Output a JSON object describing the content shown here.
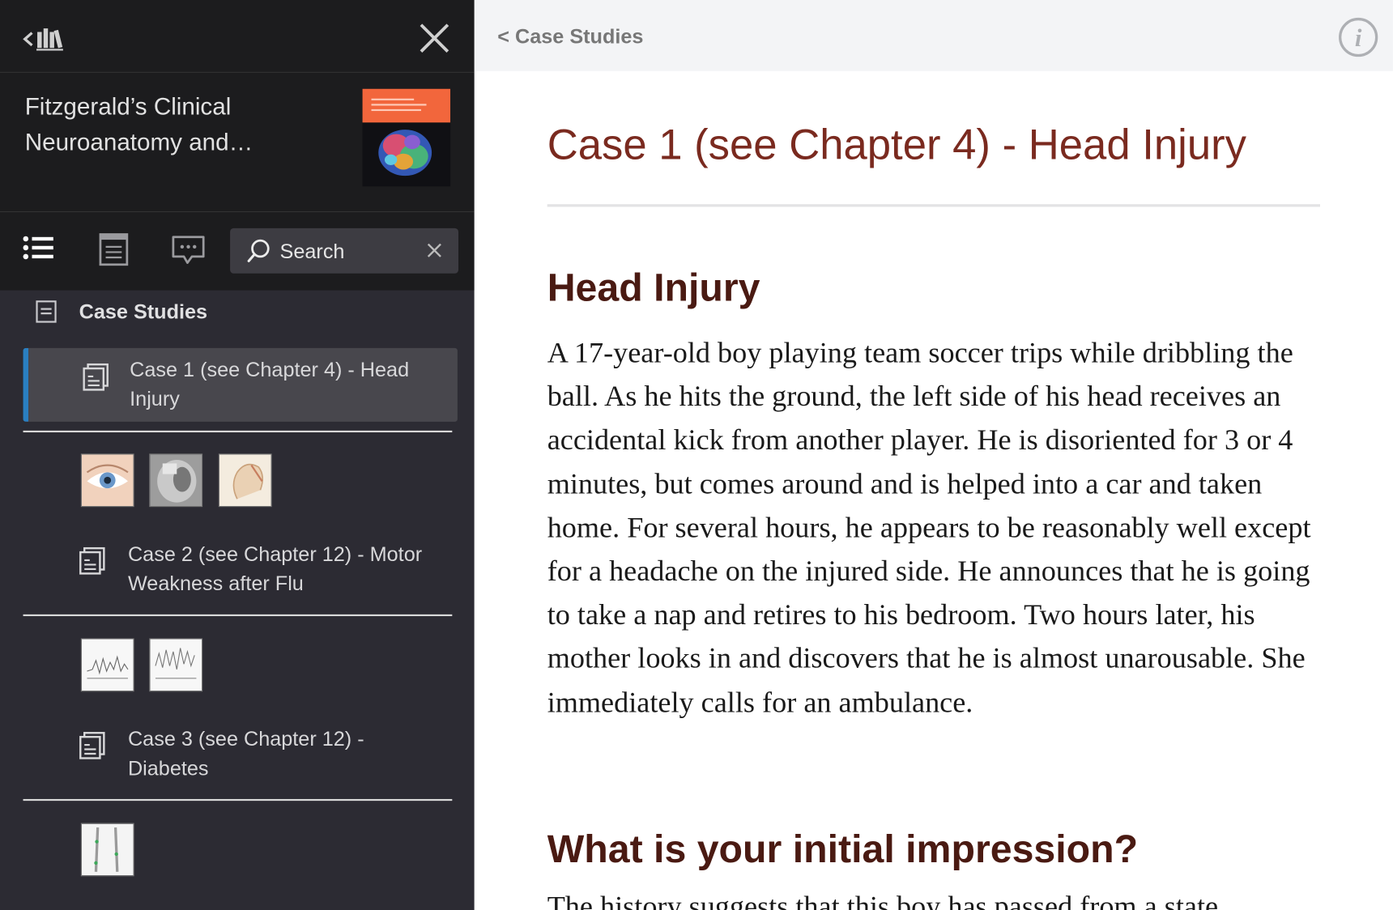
{
  "sidebar": {
    "book_title": "Fitzgerald’s Clinical Neuroanatomy and…",
    "search": {
      "placeholder": "Search"
    },
    "section": {
      "label": "Case Studies"
    },
    "items": [
      {
        "label": "Case 1 (see Chapter 4) - Head Injury",
        "active": true
      },
      {
        "label": "Case 2 (see Chapter 12) - Motor Weakness after Flu",
        "active": false
      },
      {
        "label": "Case 3 (see Chapter 12) - Diabetes",
        "active": false
      }
    ]
  },
  "main": {
    "back_label": "< Case Studies",
    "title": "Case 1 (see Chapter 4) - Head Injury",
    "section1": {
      "heading": "Head Injury",
      "body": "A 17-year-old boy playing team soccer trips while dribbling the ball. As he hits the ground, the left side of his head receives an accidental kick from another player. He is disoriented for 3 or 4 minutes, but comes around and is helped into a car and taken home. For several hours, he appears to be reasonably well except for a headache on the injured side. He announces that he is going to take a nap and retires to his bedroom. Two hours later, his mother looks in and discovers that he is almost unarousable. She immediately calls for an ambulance."
    },
    "section2": {
      "heading": "What is your initial impression?",
      "body": "The history suggests that this boy has passed from a state"
    }
  },
  "colors": {
    "sidebar_bg": "#2c2b33",
    "sidebar_header_bg": "#1c1c1e",
    "active_accent": "#2a7fc1",
    "title_color": "#7a2a1f",
    "heading_color": "#4a1a12",
    "cover_accent": "#f2663c"
  },
  "icons": [
    "library-icon",
    "close-icon",
    "toc-list-icon",
    "notes-icon",
    "comments-icon",
    "search-icon",
    "clear-icon",
    "document-icon",
    "info-icon"
  ]
}
